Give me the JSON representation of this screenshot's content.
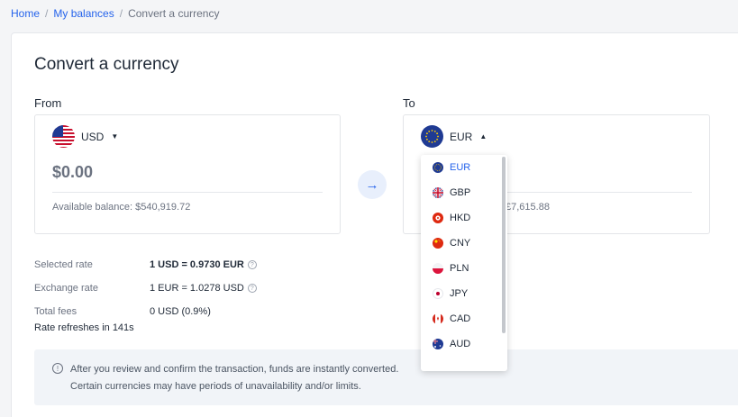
{
  "breadcrumb": {
    "home": "Home",
    "balances": "My balances",
    "current": "Convert a currency"
  },
  "page": {
    "title": "Convert a currency"
  },
  "from": {
    "label": "From",
    "currency": "USD",
    "amount": "$0.00",
    "balance": "Available balance: $540,919.72"
  },
  "to": {
    "label": "To",
    "currency": "EUR",
    "balance_partial": "£7,615.88"
  },
  "rates": {
    "selected_label": "Selected rate",
    "selected_value": "1 USD = 0.9730 EUR",
    "exchange_label": "Exchange rate",
    "exchange_value": "1 EUR = 1.0278 USD",
    "fees_label": "Total fees",
    "fees_value": "0 USD (0.9%)"
  },
  "refresh": "Rate refreshes in 141s",
  "notice": {
    "line1": "After you review and confirm the transaction, funds are instantly converted.",
    "line2": "Certain currencies may have periods of unavailability and/or limits."
  },
  "dropdown": {
    "items": [
      {
        "code": "EUR",
        "icon": "eu-flag-icon",
        "selected": true
      },
      {
        "code": "GBP",
        "icon": "uk-flag-icon"
      },
      {
        "code": "HKD",
        "icon": "hk-flag-icon"
      },
      {
        "code": "CNY",
        "icon": "cn-flag-icon"
      },
      {
        "code": "PLN",
        "icon": "pl-flag-icon"
      },
      {
        "code": "JPY",
        "icon": "jp-flag-icon"
      },
      {
        "code": "CAD",
        "icon": "ca-flag-icon"
      },
      {
        "code": "AUD",
        "icon": "au-flag-icon"
      }
    ]
  },
  "colors": {
    "accent": "#2563eb",
    "swap_bg": "#e8effc",
    "notice_bg": "#f1f4f8"
  }
}
